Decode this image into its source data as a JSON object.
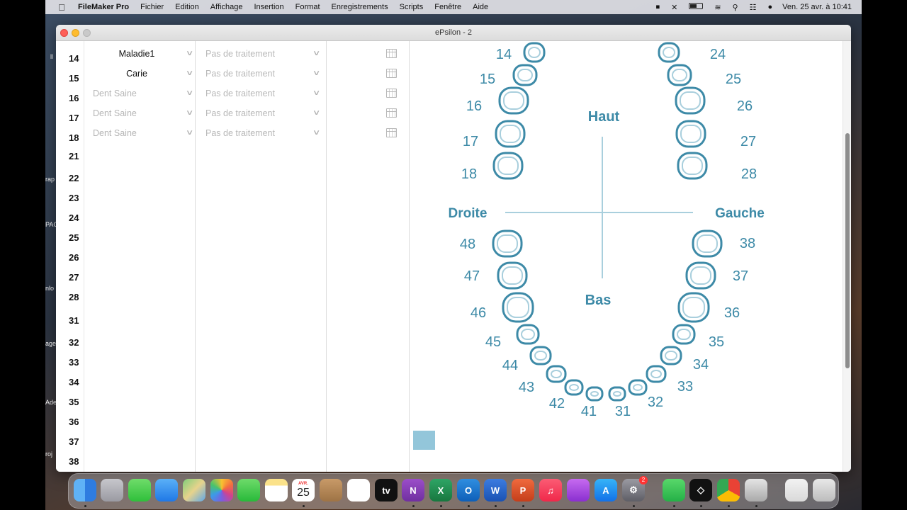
{
  "menubar": {
    "app_name": "FileMaker Pro",
    "menus": [
      "Fichier",
      "Edition",
      "Affichage",
      "Insertion",
      "Format",
      "Enregistrements",
      "Scripts",
      "Fenêtre",
      "Aide"
    ],
    "clock": "Ven. 25 avr. à  10:41"
  },
  "window": {
    "title": "ePsilon - 2"
  },
  "tooth_numbers": [
    "14",
    "15",
    "16",
    "17",
    "18",
    "21",
    "22",
    "23",
    "24",
    "25",
    "26",
    "27",
    "28",
    "31",
    "32",
    "33",
    "34",
    "35",
    "36",
    "37",
    "38"
  ],
  "rows": [
    {
      "diagnosis": "Maladie1",
      "diagnosis_filled": true,
      "treatment": "Pas de traitement"
    },
    {
      "diagnosis": "Carie",
      "diagnosis_filled": true,
      "treatment": "Pas de traitement"
    },
    {
      "diagnosis": "Dent Saine",
      "diagnosis_filled": false,
      "treatment": "Pas de traitement"
    },
    {
      "diagnosis": "Dent Saine",
      "diagnosis_filled": false,
      "treatment": "Pas de traitement"
    },
    {
      "diagnosis": "Dent Saine",
      "diagnosis_filled": false,
      "treatment": "Pas de traitement"
    }
  ],
  "dental_chart": {
    "labels": {
      "top": "Haut",
      "bottom": "Bas",
      "left": "Droite",
      "right": "Gauche"
    },
    "upper_right": [
      "14",
      "15",
      "16",
      "17",
      "18"
    ],
    "upper_left": [
      "24",
      "25",
      "26",
      "27",
      "28"
    ],
    "lower_right": [
      "48",
      "47",
      "46",
      "45",
      "44",
      "43",
      "42",
      "41"
    ],
    "lower_left": [
      "38",
      "37",
      "36",
      "35",
      "34",
      "33",
      "32",
      "31"
    ],
    "color": "#3d8aa7"
  },
  "dock": {
    "calendar_month": "AVR.",
    "calendar_day": "25",
    "system_prefs_badge": "2"
  }
}
